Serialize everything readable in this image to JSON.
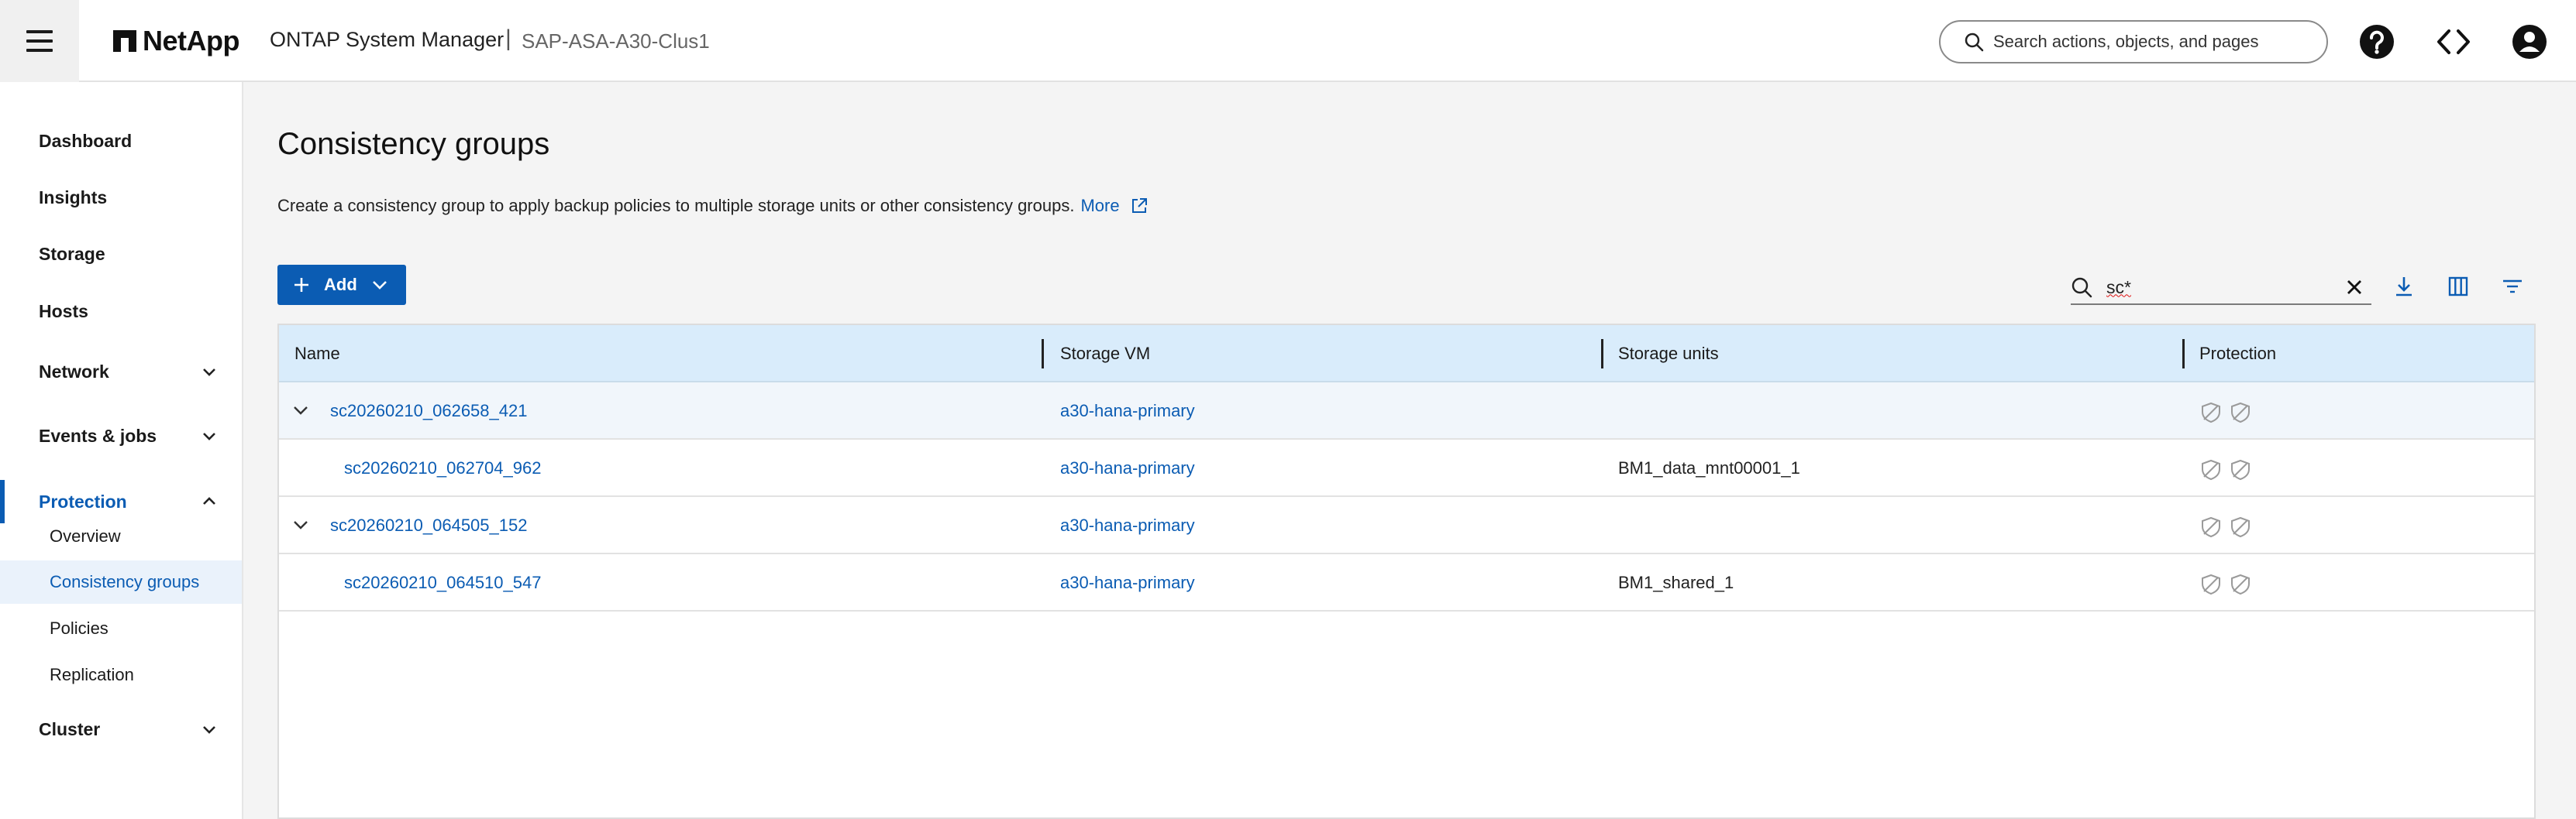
{
  "header": {
    "brand": "NetApp",
    "app_title": "ONTAP System Manager",
    "separator": "|",
    "cluster": "SAP-ASA-A30-Clus1",
    "search_placeholder": "Search actions, objects, and pages"
  },
  "sidebar": {
    "items": [
      {
        "label": "Dashboard"
      },
      {
        "label": "Insights"
      },
      {
        "label": "Storage"
      },
      {
        "label": "Hosts"
      },
      {
        "label": "Network"
      },
      {
        "label": "Events & jobs"
      },
      {
        "label": "Protection"
      },
      {
        "label": "Cluster"
      }
    ],
    "protection_sub": [
      {
        "label": "Overview"
      },
      {
        "label": "Consistency groups"
      },
      {
        "label": "Policies"
      },
      {
        "label": "Replication"
      }
    ]
  },
  "main": {
    "title": "Consistency groups",
    "description": "Create a consistency group to apply backup policies to multiple storage units or other consistency groups.",
    "more_link": "More",
    "add_label": "Add",
    "filter_value": "sc*"
  },
  "table": {
    "columns": [
      "Name",
      "Storage VM",
      "Storage units",
      "Protection"
    ],
    "rows": [
      {
        "name": "sc20260210_062658_421",
        "svm": "a30-hana-primary",
        "units": "",
        "parent": true
      },
      {
        "name": "sc20260210_062704_962",
        "svm": "a30-hana-primary",
        "units": "BM1_data_mnt00001_1",
        "parent": false
      },
      {
        "name": "sc20260210_064505_152",
        "svm": "a30-hana-primary",
        "units": "",
        "parent": true
      },
      {
        "name": "sc20260210_064510_547",
        "svm": "a30-hana-primary",
        "units": "BM1_shared_1",
        "parent": false
      }
    ]
  },
  "colors": {
    "accent": "#0b5cb3",
    "header_row": "#d9ecfb",
    "selected_nav_bg": "#eaf2fb"
  },
  "icons": [
    "menu-icon",
    "netapp-logo-icon",
    "search-icon",
    "help-icon",
    "code-icon",
    "account-icon",
    "chevron-down-icon",
    "chevron-up-icon",
    "external-link-icon",
    "plus-icon",
    "clear-icon",
    "download-icon",
    "columns-icon",
    "filter-icon",
    "shield-icon"
  ]
}
